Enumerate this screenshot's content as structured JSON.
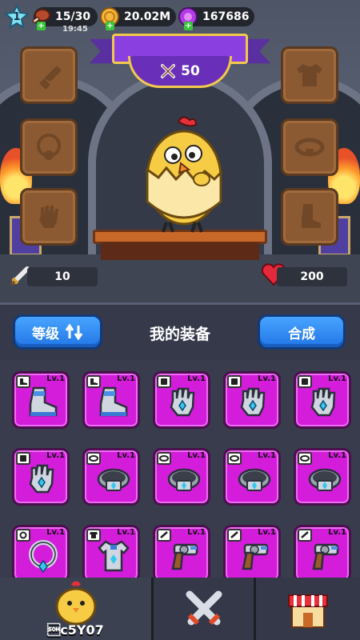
{
  "player": {
    "level": "1"
  },
  "resources": {
    "energy": "15/30",
    "energy_timer": "19:45",
    "gold": "20.02M",
    "gems": "167686"
  },
  "hero": {
    "power": "50"
  },
  "stats": {
    "attack": "10",
    "health": "200"
  },
  "equipment_slots": {
    "left": [
      "weapon",
      "necklace",
      "glove"
    ],
    "right": [
      "armor",
      "belt",
      "boots"
    ]
  },
  "panel": {
    "sort_label": "等级",
    "title": "我的装备",
    "merge_label": "合成"
  },
  "inventory": [
    {
      "type": "boots",
      "level": "Lv.1"
    },
    {
      "type": "boots",
      "level": "Lv.1"
    },
    {
      "type": "glove",
      "level": "Lv.1"
    },
    {
      "type": "glove",
      "level": "Lv.1"
    },
    {
      "type": "glove",
      "level": "Lv.1"
    },
    {
      "type": "glove",
      "level": "Lv.1"
    },
    {
      "type": "belt",
      "level": "Lv.1"
    },
    {
      "type": "belt",
      "level": "Lv.1"
    },
    {
      "type": "belt",
      "level": "Lv.1"
    },
    {
      "type": "belt",
      "level": "Lv.1"
    },
    {
      "type": "necklace",
      "level": "Lv.1"
    },
    {
      "type": "armor",
      "level": "Lv.1"
    },
    {
      "type": "weapon",
      "level": "Lv.1"
    },
    {
      "type": "weapon",
      "level": "Lv.1"
    },
    {
      "type": "weapon",
      "level": "Lv.1"
    }
  ],
  "nav": {
    "hero_label": "\u0001c5Y07",
    "tabs": [
      "hero",
      "battle",
      "shop"
    ]
  },
  "colors": {
    "card_purple": "#d31ddb",
    "button_blue": "#2f8af2",
    "slot_brown": "#8b5a33"
  }
}
